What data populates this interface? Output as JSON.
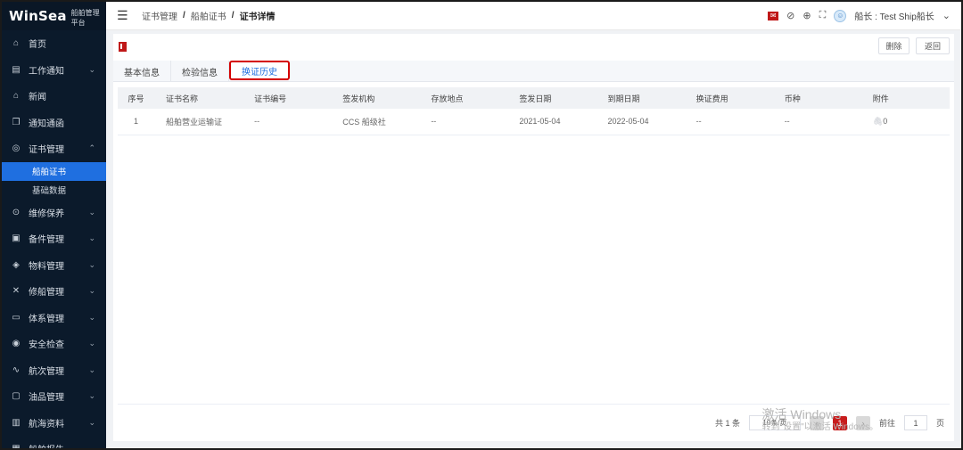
{
  "brand": {
    "logo": "WinSea",
    "subtitle": "船舶管理平台"
  },
  "sidebar": {
    "items": [
      {
        "label": "首页",
        "icon": "home-icon",
        "glyph": "⌂",
        "chevron": ""
      },
      {
        "label": "工作通知",
        "icon": "notice-icon",
        "glyph": "▤",
        "chevron": "⌄"
      },
      {
        "label": "新闻",
        "icon": "news-icon",
        "glyph": "⌂",
        "chevron": ""
      },
      {
        "label": "通知通函",
        "icon": "circular-icon",
        "glyph": "❐",
        "chevron": ""
      },
      {
        "label": "证书管理",
        "icon": "certificate-icon",
        "glyph": "◎",
        "chevron": "⌃"
      },
      {
        "label": "维修保养",
        "icon": "maintenance-icon",
        "glyph": "⊙",
        "chevron": "⌄"
      },
      {
        "label": "备件管理",
        "icon": "spare-parts-icon",
        "glyph": "▣",
        "chevron": "⌄"
      },
      {
        "label": "物料管理",
        "icon": "material-icon",
        "glyph": "◈",
        "chevron": "⌄"
      },
      {
        "label": "修船管理",
        "icon": "repair-icon",
        "glyph": "✕",
        "chevron": "⌄"
      },
      {
        "label": "体系管理",
        "icon": "system-icon",
        "glyph": "▭",
        "chevron": "⌄"
      },
      {
        "label": "安全检查",
        "icon": "safety-icon",
        "glyph": "◉",
        "chevron": "⌄"
      },
      {
        "label": "航次管理",
        "icon": "voyage-icon",
        "glyph": "∿",
        "chevron": "⌄"
      },
      {
        "label": "油品管理",
        "icon": "oil-icon",
        "glyph": "▢",
        "chevron": "⌄"
      },
      {
        "label": "航海资料",
        "icon": "nautical-docs-icon",
        "glyph": "▥",
        "chevron": "⌄"
      },
      {
        "label": "船舶报告",
        "icon": "report-icon",
        "glyph": "▦",
        "chevron": "⌄"
      }
    ],
    "sub_items": [
      {
        "label": "船舶证书",
        "active": true
      },
      {
        "label": "基础数据",
        "active": false
      }
    ]
  },
  "header": {
    "breadcrumb": [
      "证书管理",
      "船舶证书",
      "证书详情"
    ],
    "user": "船长 : Test Ship船长"
  },
  "toolbar": {
    "delete_label": "删除",
    "back_label": "返回"
  },
  "tabs": [
    "基本信息",
    "检验信息",
    "换证历史"
  ],
  "active_tab": 2,
  "table": {
    "headers": [
      "序号",
      "证书名称",
      "证书编号",
      "签发机构",
      "存放地点",
      "签发日期",
      "到期日期",
      "换证费用",
      "币种",
      "附件"
    ],
    "rows": [
      [
        "1",
        "船舶营业运输证",
        "--",
        "CCS 船级社",
        "--",
        "2021-05-04",
        "2022-05-04",
        "--",
        "--",
        "0"
      ]
    ]
  },
  "pagination": {
    "total": "共 1 条",
    "page_size": "10条/页",
    "current": "1",
    "goto_label": "前往",
    "goto_value": "1",
    "page_unit": "页"
  },
  "watermark": {
    "line1": "激活 Windows",
    "line2": "转到\"设置\"以激活 Windows。"
  },
  "colors": {
    "sidebar_bg": "#0b1a2b",
    "active_blue": "#1f6fe0",
    "accent_red": "#c81d1d"
  }
}
